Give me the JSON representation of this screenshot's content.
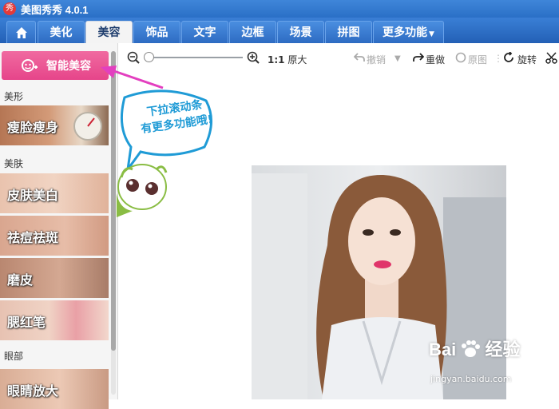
{
  "titlebar": {
    "title": "美图秀秀 4.0.1",
    "logo_char": "秀"
  },
  "menu": {
    "home_icon": "home-icon",
    "tabs": [
      {
        "label": "美化"
      },
      {
        "label": "美容"
      },
      {
        "label": "饰品"
      },
      {
        "label": "文字"
      },
      {
        "label": "边框"
      },
      {
        "label": "场景"
      },
      {
        "label": "拼图"
      },
      {
        "label": "更多功能"
      }
    ],
    "active_tab": "美容"
  },
  "left_panel": {
    "smart_button": "智能美容",
    "sections": [
      {
        "label": "美形",
        "items": [
          {
            "label": "瘦脸瘦身"
          }
        ]
      },
      {
        "label": "美肤",
        "items": [
          {
            "label": "皮肤美白"
          },
          {
            "label": "祛痘祛斑"
          },
          {
            "label": "磨皮"
          },
          {
            "label": "腮红笔"
          }
        ]
      },
      {
        "label": "眼部",
        "items": [
          {
            "label": "眼睛放大"
          }
        ]
      }
    ]
  },
  "toolbar": {
    "zoom_label_strong": "1:1",
    "zoom_label": "原大",
    "undo": "撤销",
    "redo": "重做",
    "original": "原图",
    "rotate": "旋转"
  },
  "tip": {
    "line1": "下拉滚动条",
    "line2": "有更多功能哦!"
  },
  "watermark": {
    "main": "Bai",
    "main2": "经验",
    "sub": "jingyan.baidu.com"
  },
  "colors": {
    "accent_pink": "#e6458a",
    "titlebar_blue": "#2a6fc6",
    "tip_blue": "#1f9bd6"
  }
}
